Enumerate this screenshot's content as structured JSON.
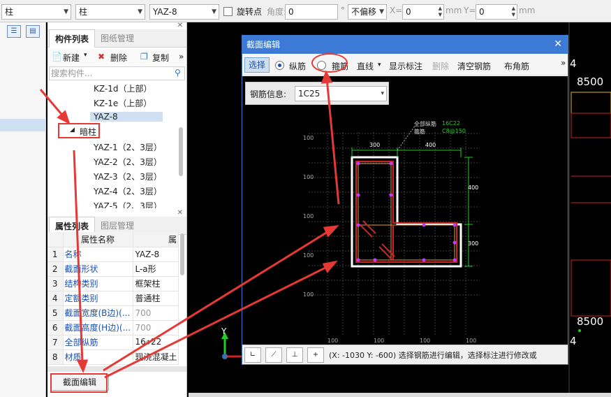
{
  "toolbar": {
    "type_select": "柱",
    "sub_select": "柱",
    "component_select": "YAZ-8",
    "rotate_label": "旋转点",
    "angle_label": "角度:",
    "angle_value": "0",
    "degree_symbol": "°",
    "offset_select": "不偏移",
    "x_label": "X=",
    "x_value": "0",
    "mm1": "mm",
    "y_label": "Y=",
    "y_value": "0",
    "mm2": "mm"
  },
  "component_panel": {
    "tabs": [
      "构件列表",
      "图纸管理"
    ],
    "buttons": {
      "new": "新建",
      "delete": "删除",
      "copy": "复制",
      "more": "»"
    },
    "search_placeholder": "搜索构件...",
    "tree": {
      "items_before": [
        "KZ-1d（上部）",
        "KZ-1e（上部）"
      ],
      "selected": "YAZ-8",
      "group_label": "暗柱",
      "items_after": [
        "YAZ-1（2、3层）",
        "YAZ-2（2、3层）",
        "YAZ-3（2、3层）",
        "YAZ-4（2、3层）",
        "YAZ-5（2、3层）"
      ]
    }
  },
  "property_panel": {
    "tabs": [
      "属性列表",
      "图层管理"
    ],
    "header_name": "属性名称",
    "header_value": "属",
    "rows": [
      {
        "n": "1",
        "name": "名称",
        "value": "YAZ-8"
      },
      {
        "n": "2",
        "name": "截面形状",
        "value": "L-a形"
      },
      {
        "n": "3",
        "name": "结构类别",
        "value": "框架柱"
      },
      {
        "n": "4",
        "name": "定额类别",
        "value": "普通柱"
      },
      {
        "n": "5",
        "name": "截面宽度(B边)(...",
        "value": "700"
      },
      {
        "n": "6",
        "name": "截面高度(H边)(...",
        "value": "700"
      },
      {
        "n": "7",
        "name": "全部纵筋",
        "value": "16⌽22"
      },
      {
        "n": "8",
        "name": "材质",
        "value": "现浇混凝土"
      }
    ],
    "edit_button": "截面编辑"
  },
  "dialog": {
    "title": "截面编辑",
    "toolbar": {
      "select": "选择",
      "longitudinal": "纵筋",
      "stirrup": "箍筋",
      "line": "直线",
      "show_dim": "显示标注",
      "delete": "删除",
      "clear": "清空钢筋",
      "corner": "布角筋",
      "more": "»"
    },
    "rebar_info_label": "钢筋信息:",
    "rebar_info_value": "1C25",
    "drawing": {
      "all_long_label": "全部纵筋",
      "all_long_value": "16C22",
      "stirrup_label": "箍筋",
      "stirrup_value": "C8@150",
      "dim_top_left": "300",
      "dim_top_right": "400",
      "dim_right_top": "400",
      "dim_right_bottom": "300",
      "grid_label": "100"
    },
    "status_text": "(X: -1030 Y: -600) 选择钢筋进行编辑，选择标注进行修改或"
  },
  "cad": {
    "labels": [
      "4",
      "8500",
      "8500",
      "4"
    ],
    "axis_y": "Y"
  },
  "colors": {
    "dialog_title_bg": "#3c7ad6",
    "annotation_red": "#e53935",
    "dim_green": "#22cc22"
  }
}
